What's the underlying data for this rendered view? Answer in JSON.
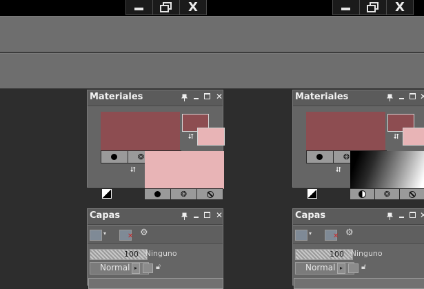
{
  "window_controls": [
    {
      "minimize": "minimize",
      "restore": "restore",
      "close": "X"
    },
    {
      "minimize": "minimize",
      "restore": "restore",
      "close": "X"
    }
  ],
  "panels": [
    {
      "materials_title": "Materiales",
      "foreground_color": "#8d4d51",
      "background_color": "#e8b4b6",
      "properties_style": "color",
      "layers_title": "Capas",
      "opacity_value": "100",
      "blend_none_label": "Ninguno",
      "blend_mode": "Normal"
    },
    {
      "materials_title": "Materiales",
      "foreground_color": "#8d4d51",
      "background_color": "#e8b4b6",
      "properties_style": "gradient",
      "layers_title": "Capas",
      "opacity_value": "100",
      "blend_none_label": "Ninguno",
      "blend_mode": "Normal"
    }
  ],
  "icons": {
    "pin": "pin-icon",
    "minimize": "minimize-icon",
    "maximize": "maximize-icon",
    "close": "close-icon",
    "color": "color-dot-icon",
    "pattern": "pattern-icon",
    "none": "no-style-icon",
    "swap": "swap-colors-icon",
    "reset": "default-colors-icon",
    "new_layer": "new-layer-icon",
    "delete_layer": "delete-layer-icon",
    "settings": "gear-icon",
    "lock": "lock-icon",
    "link": "link-icon",
    "mask": "mask-icon"
  },
  "colors": {
    "panel_bg": "#656565",
    "toolbar_bg": "#6e6e6e",
    "workspace_bg": "#2d2d2d",
    "title_bar": "#000000"
  }
}
